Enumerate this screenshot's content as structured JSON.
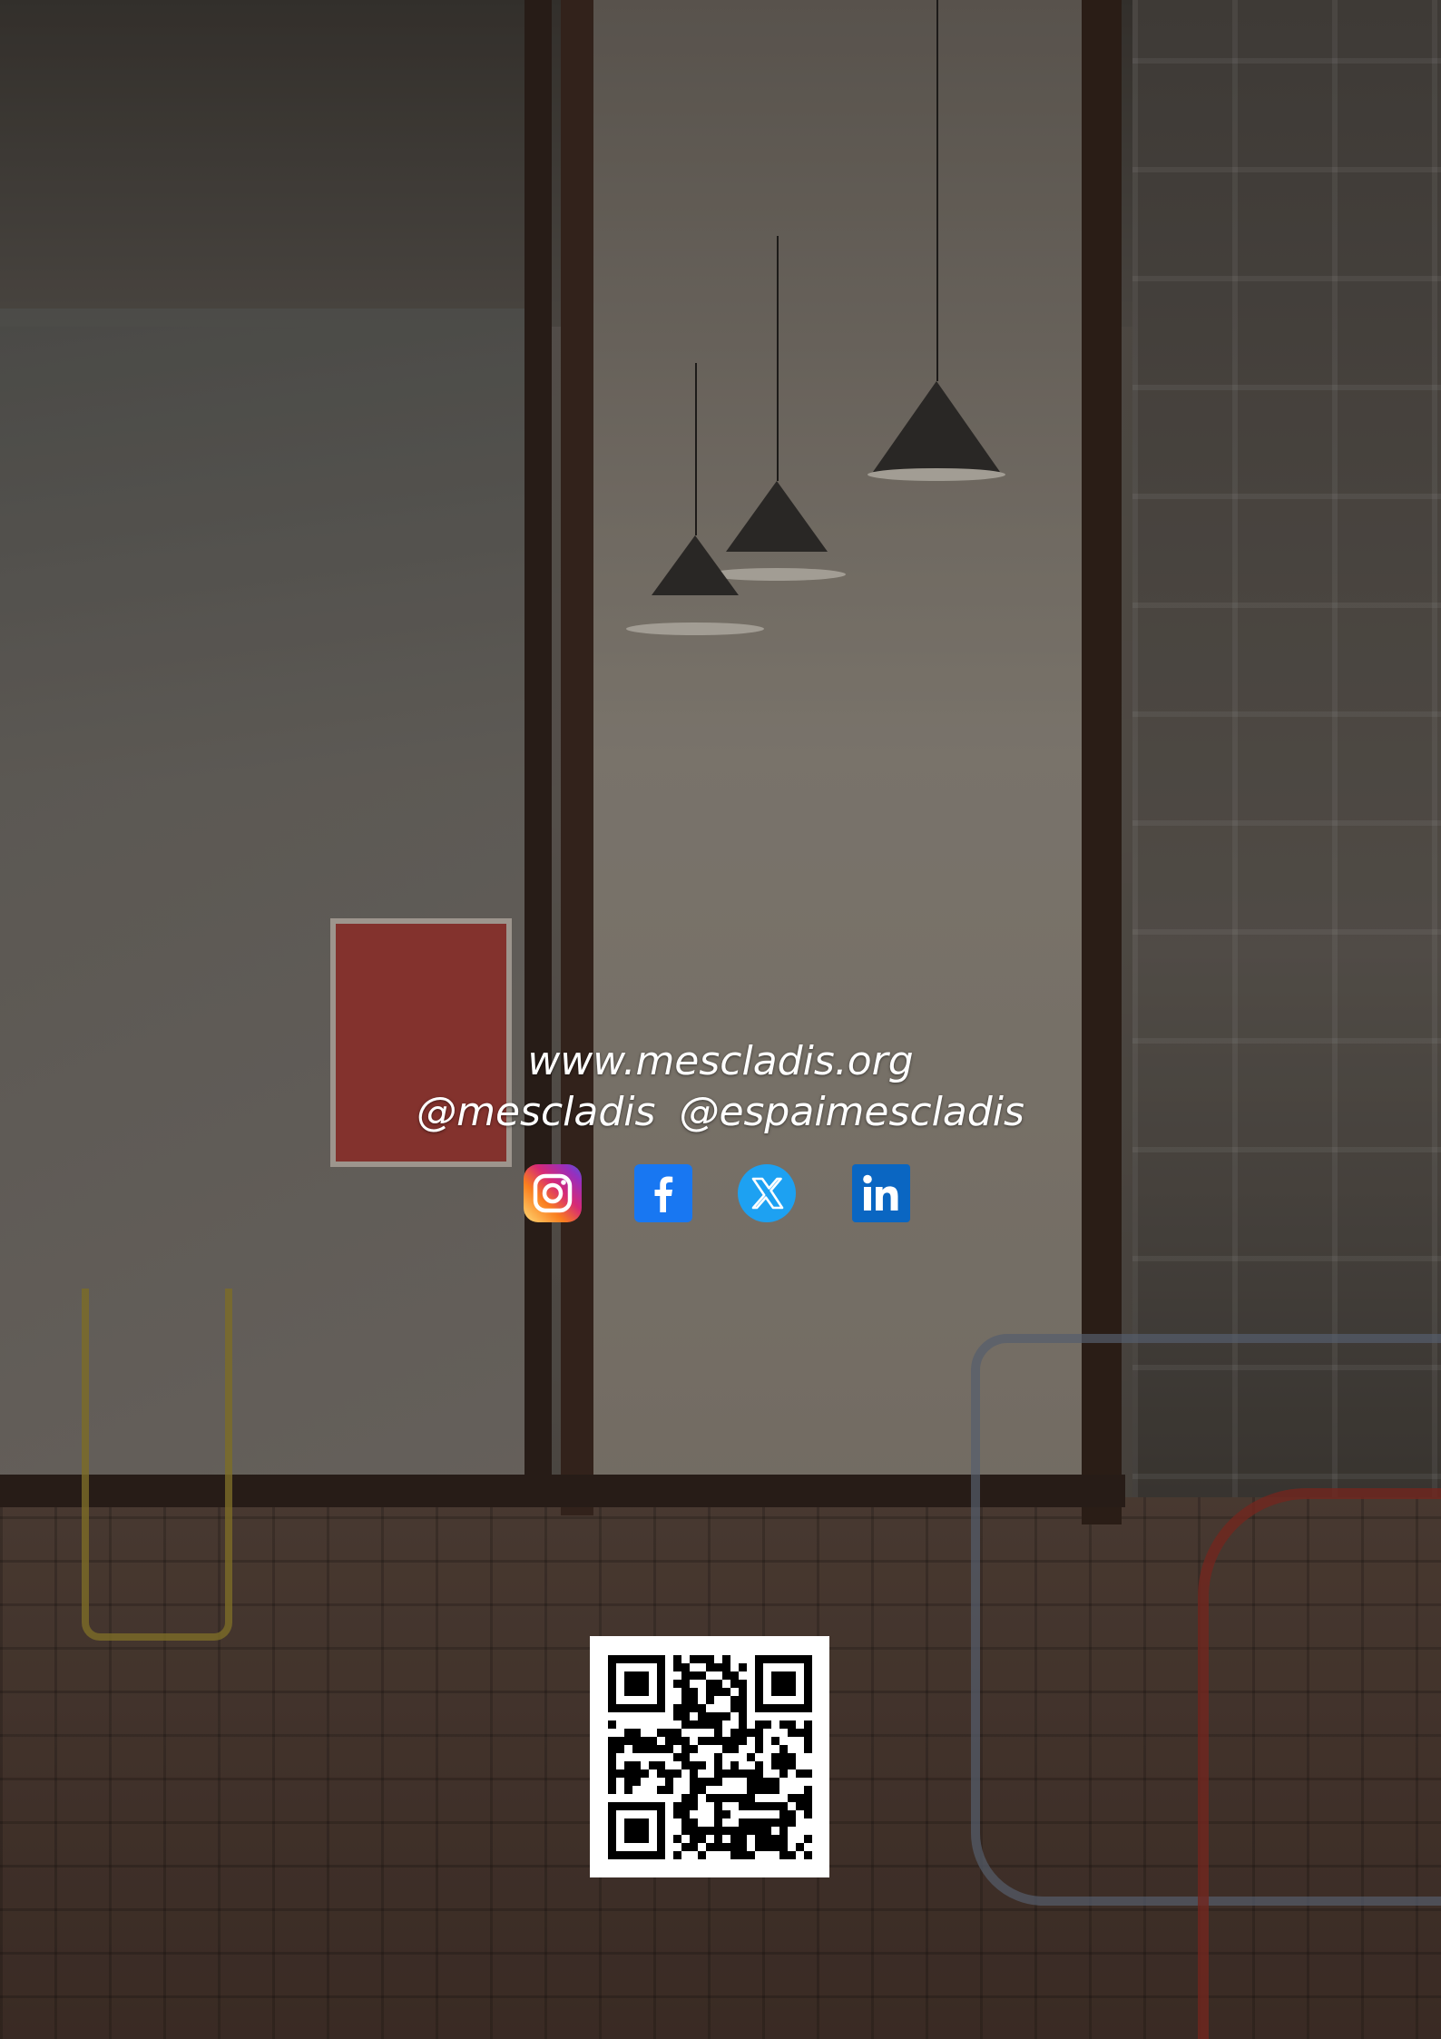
{
  "contact": {
    "website": "www.mescladis.org",
    "handle_primary": "@mescladis",
    "handle_secondary": "@espaimescladis"
  },
  "social_icons": [
    {
      "name": "instagram-icon",
      "color": "#e1306c"
    },
    {
      "name": "facebook-icon",
      "color": "#1877f2"
    },
    {
      "name": "x-twitter-icon",
      "color": "#1da1f2"
    },
    {
      "name": "linkedin-icon",
      "color": "#0a66c2"
    }
  ],
  "qr_code": {
    "icon": "qr-code"
  },
  "colors": {
    "text": "#ffffff",
    "overlay": "rgba(0,0,0,0.32)"
  }
}
